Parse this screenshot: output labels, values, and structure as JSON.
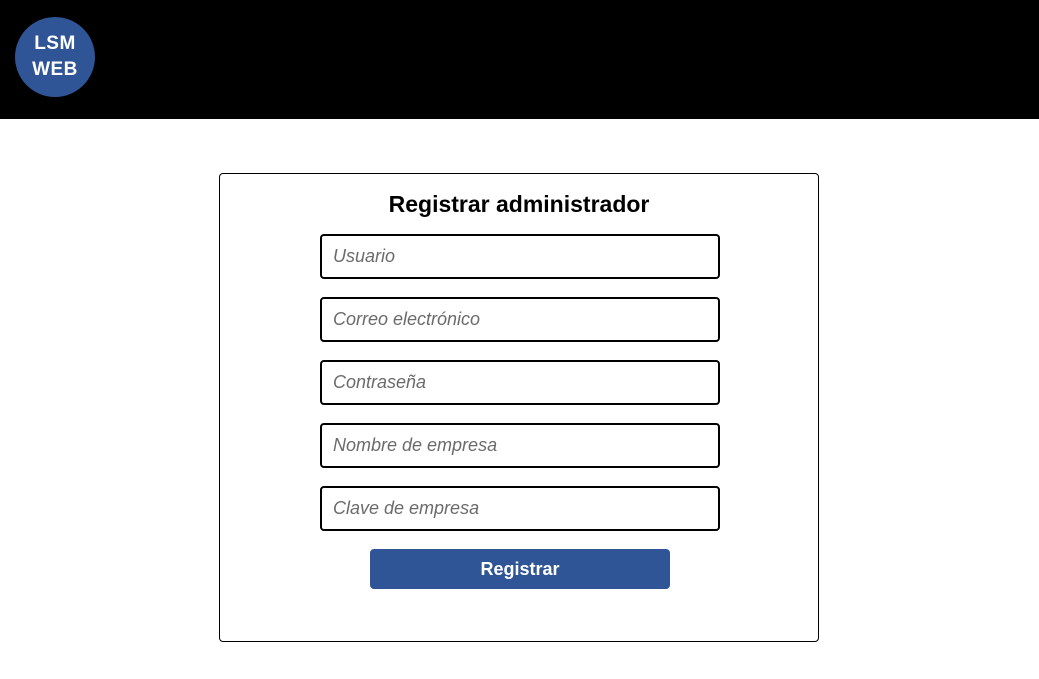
{
  "header": {
    "logo_line1": "LSM",
    "logo_line2": "WEB",
    "logo_color": "#2f5597",
    "bar_color": "#000000"
  },
  "form": {
    "title": "Registrar administrador",
    "fields": [
      {
        "placeholder": "Usuario",
        "value": ""
      },
      {
        "placeholder": "Correo electrónico",
        "value": ""
      },
      {
        "placeholder": "Contraseña",
        "value": ""
      },
      {
        "placeholder": "Nombre de empresa",
        "value": ""
      },
      {
        "placeholder": "Clave de empresa",
        "value": ""
      }
    ],
    "submit_label": "Registrar",
    "accent_color": "#2f5597"
  }
}
